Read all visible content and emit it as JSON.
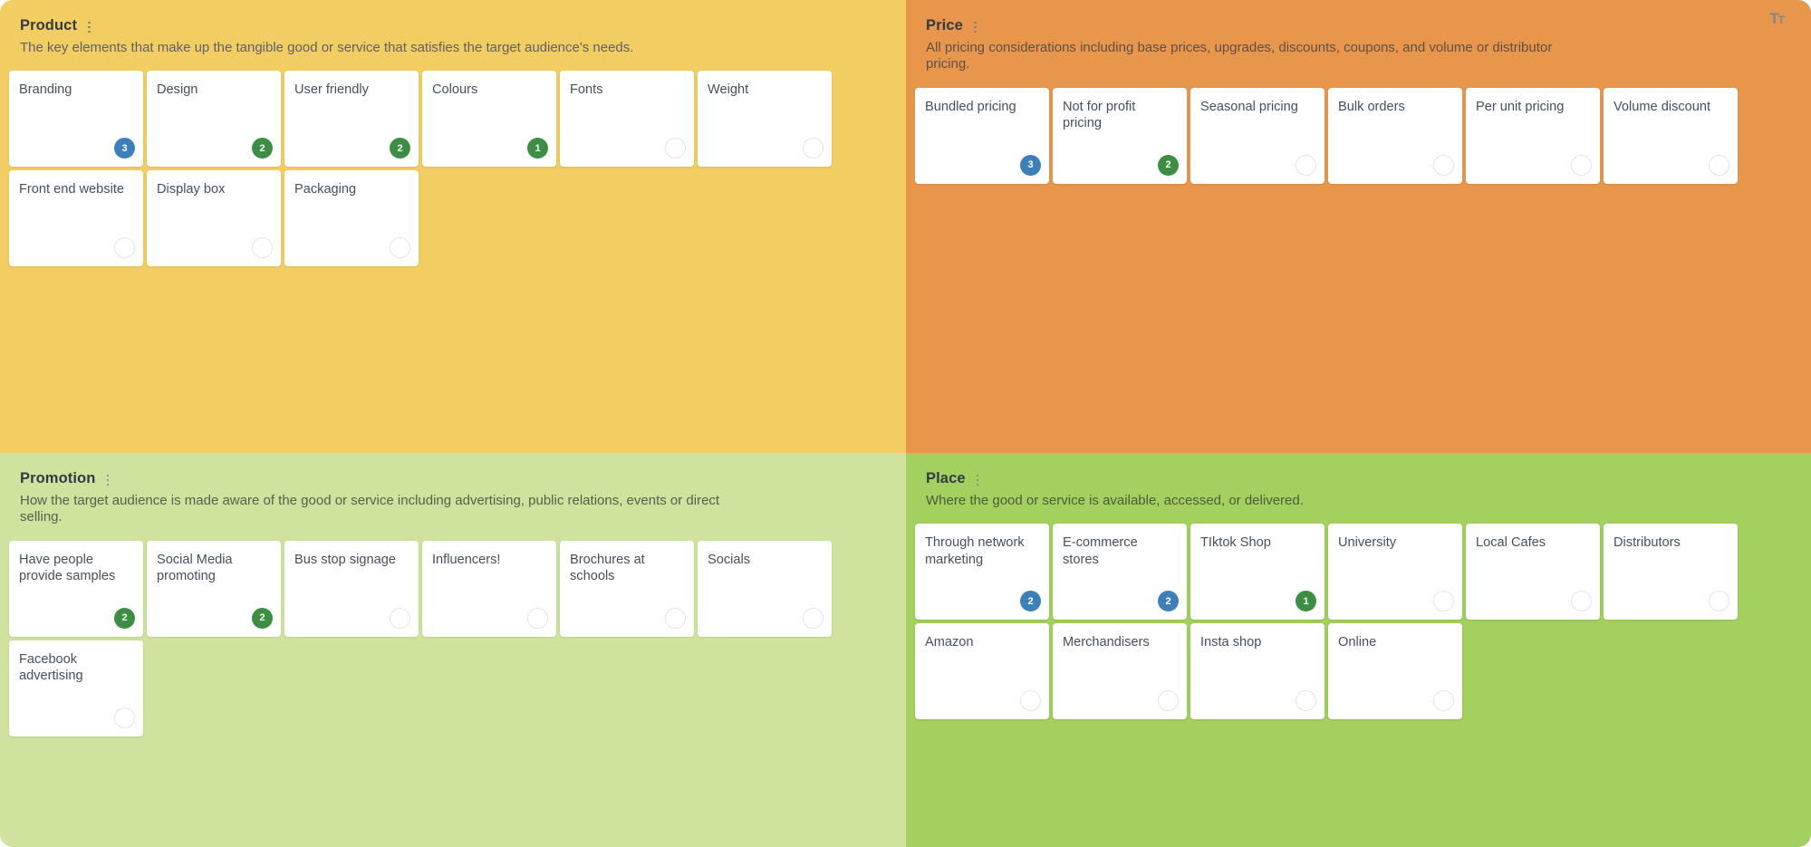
{
  "toolbar": {
    "text_size_icon_label": "T",
    "text_size_icon_sub": "T"
  },
  "quadrants": [
    {
      "key": "product",
      "title": "Product",
      "menu_icon": "kebab-menu-icon",
      "description": "The key elements that make up the tangible good or service that satisfies the target audience's needs.",
      "cards": [
        {
          "text": "Branding",
          "badge": "3",
          "badge_color": "blue"
        },
        {
          "text": "Design",
          "badge": "2",
          "badge_color": "green"
        },
        {
          "text": "User friendly",
          "badge": "2",
          "badge_color": "green"
        },
        {
          "text": "Colours",
          "badge": "1",
          "badge_color": "green"
        },
        {
          "text": "Fonts",
          "badge": "",
          "badge_color": "empty"
        },
        {
          "text": "Weight",
          "badge": "",
          "badge_color": "empty"
        },
        {
          "text": "Front end website",
          "badge": "",
          "badge_color": "empty"
        },
        {
          "text": "Display box",
          "badge": "",
          "badge_color": "empty"
        },
        {
          "text": "Packaging",
          "badge": "",
          "badge_color": "empty"
        }
      ]
    },
    {
      "key": "price",
      "title": "Price",
      "menu_icon": "kebab-menu-icon",
      "description": "All pricing considerations including base prices, upgrades, discounts, coupons, and volume or distributor pricing.",
      "cards": [
        {
          "text": "Bundled pricing",
          "badge": "3",
          "badge_color": "blue"
        },
        {
          "text": "Not for profit pricing",
          "badge": "2",
          "badge_color": "green"
        },
        {
          "text": "Seasonal pricing",
          "badge": "",
          "badge_color": "empty"
        },
        {
          "text": "Bulk orders",
          "badge": "",
          "badge_color": "empty"
        },
        {
          "text": "Per unit pricing",
          "badge": "",
          "badge_color": "empty"
        },
        {
          "text": "Volume discount",
          "badge": "",
          "badge_color": "empty"
        }
      ]
    },
    {
      "key": "promotion",
      "title": "Promotion",
      "menu_icon": "kebab-menu-icon",
      "description": "How the target audience is made aware of the good or service including advertising, public relations, events or direct selling.",
      "cards": [
        {
          "text": "Have people provide samples",
          "badge": "2",
          "badge_color": "green"
        },
        {
          "text": "Social Media promoting",
          "badge": "2",
          "badge_color": "green"
        },
        {
          "text": "Bus stop signage",
          "badge": "",
          "badge_color": "empty"
        },
        {
          "text": "Influencers!",
          "badge": "",
          "badge_color": "empty"
        },
        {
          "text": "Brochures at schools",
          "badge": "",
          "badge_color": "empty"
        },
        {
          "text": "Socials",
          "badge": "",
          "badge_color": "empty"
        },
        {
          "text": "Facebook advertising",
          "badge": "",
          "badge_color": "empty"
        }
      ]
    },
    {
      "key": "place",
      "title": "Place",
      "menu_icon": "kebab-menu-icon",
      "description": "Where the good or service is available, accessed, or delivered.",
      "cards": [
        {
          "text": "Through network marketing",
          "badge": "2",
          "badge_color": "blue"
        },
        {
          "text": "E-commerce stores",
          "badge": "2",
          "badge_color": "blue"
        },
        {
          "text": "TIktok Shop",
          "badge": "1",
          "badge_color": "green"
        },
        {
          "text": "University",
          "badge": "",
          "badge_color": "empty"
        },
        {
          "text": "Local Cafes",
          "badge": "",
          "badge_color": "empty"
        },
        {
          "text": "Distributors",
          "badge": "",
          "badge_color": "empty"
        },
        {
          "text": "Amazon",
          "badge": "",
          "badge_color": "empty"
        },
        {
          "text": "Merchandisers",
          "badge": "",
          "badge_color": "empty"
        },
        {
          "text": "Insta shop",
          "badge": "",
          "badge_color": "empty"
        },
        {
          "text": "Online",
          "badge": "",
          "badge_color": "empty"
        }
      ]
    }
  ],
  "colors": {
    "product_bg": "#f2ce62",
    "price_bg": "#e8964c",
    "promotion_bg": "#cfe39f",
    "place_bg": "#a3d05e",
    "badge_blue": "#3d7fb8",
    "badge_green": "#3c8f42"
  }
}
